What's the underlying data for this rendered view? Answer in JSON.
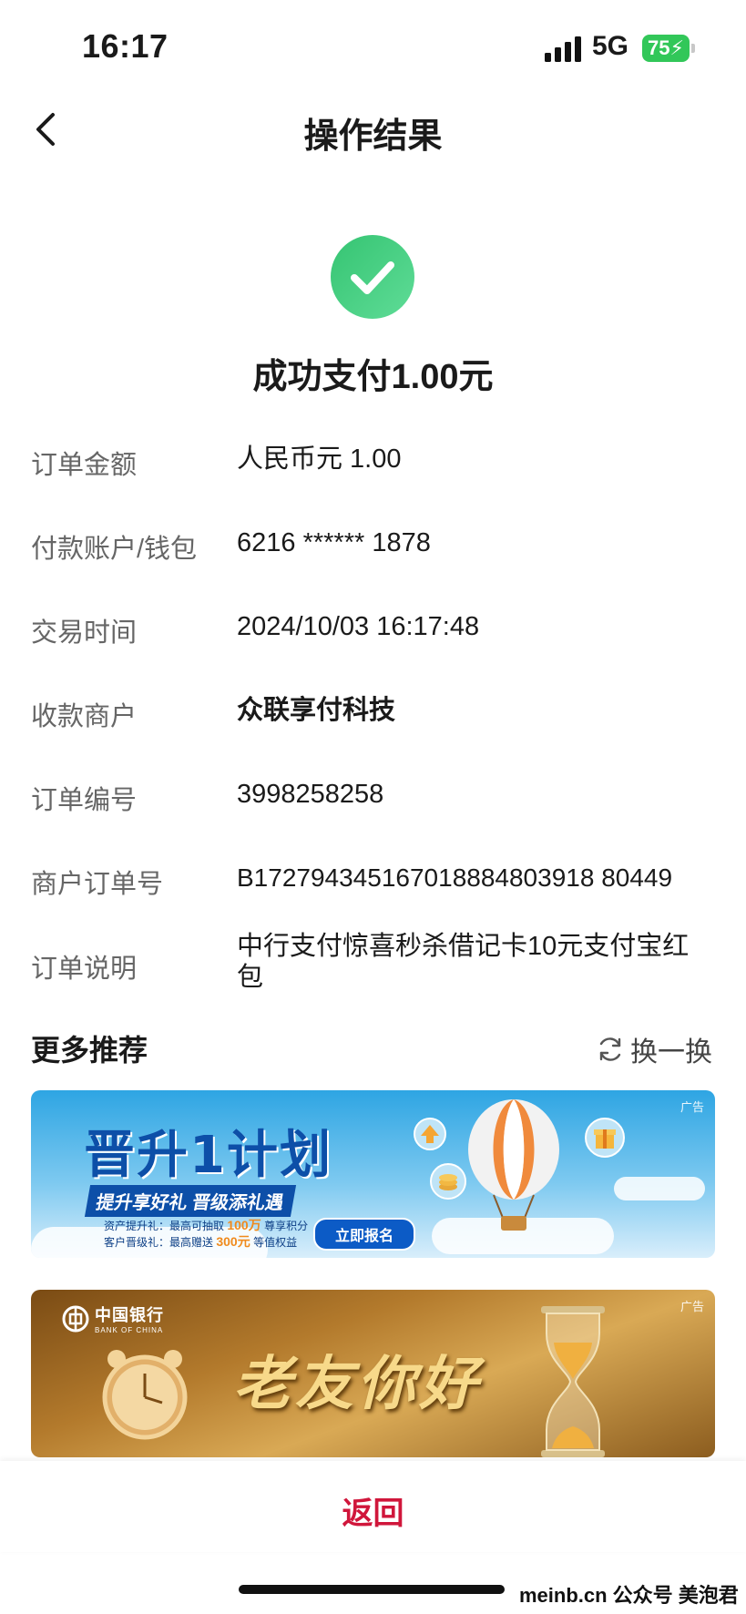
{
  "status_bar": {
    "time": "16:17",
    "network": "5G",
    "battery": "75"
  },
  "header": {
    "title": "操作结果"
  },
  "result": {
    "message": "成功支付1.00元",
    "color": "#3ecf7d"
  },
  "details": [
    {
      "label": "订单金额",
      "value": "人民币元 1.00"
    },
    {
      "label": "付款账户/钱包",
      "value": "6216 ****** 1878"
    },
    {
      "label": "交易时间",
      "value": "2024/10/03 16:17:48"
    },
    {
      "label": "收款商户",
      "value": "众联享付科技"
    },
    {
      "label": "订单编号",
      "value": "3998258258"
    },
    {
      "label": "商户订单号",
      "value": "B172794345167018884803918 80449"
    },
    {
      "label": "订单说明",
      "value": "中行支付惊喜秒杀借记卡10元支付宝红包"
    }
  ],
  "recommend": {
    "title": "更多推荐",
    "refresh_label": "换一换"
  },
  "banners": [
    {
      "ad_tag": "广告",
      "headline": "晋升1计划",
      "subline": "提升享好礼  晋级添礼遇",
      "line1_prefix": "资产提升礼：最高可抽取",
      "line1_highlight": "100万",
      "line1_suffix": "尊享积分",
      "line2_prefix": "客户晋级礼：最高赠送",
      "line2_highlight": "300元",
      "line2_suffix": "等值权益",
      "button": "立即报名"
    },
    {
      "ad_tag": "广告",
      "brand_cn": "中国银行",
      "brand_en": "BANK OF CHINA",
      "headline": "老友你好"
    }
  ],
  "footer": {
    "return_label": "返回",
    "accent": "#d0163b"
  },
  "watermark": "meinb.cn  公众号 美泡君"
}
